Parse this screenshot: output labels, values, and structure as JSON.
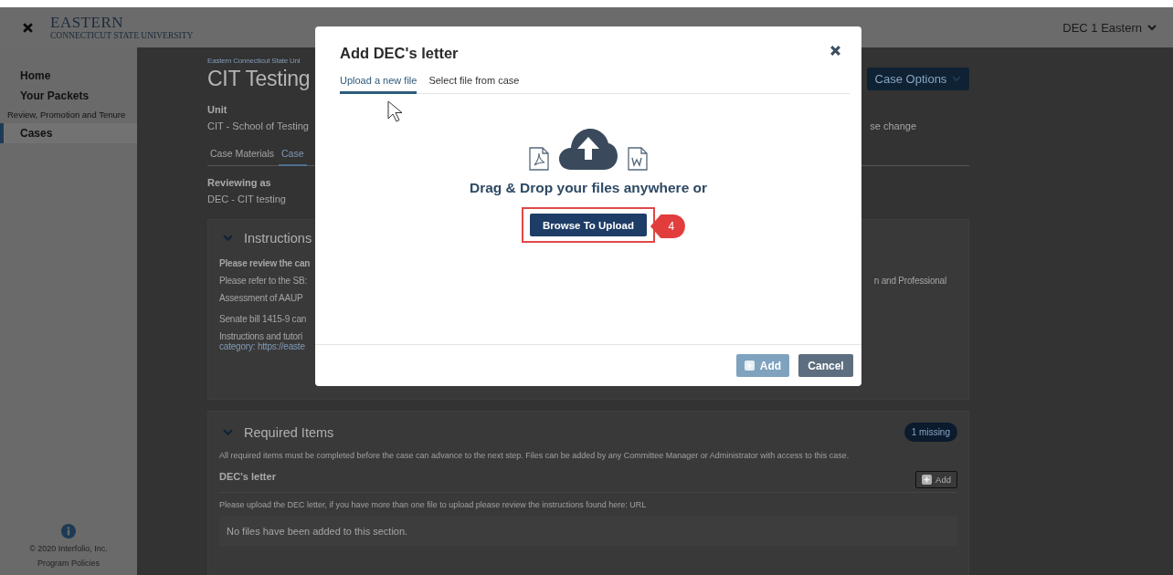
{
  "header": {
    "logo_title": "EASTERN",
    "logo_subtitle": "CONNECTICUT STATE UNIVERSITY",
    "user_menu": "DEC 1 Eastern"
  },
  "sidebar": {
    "items": [
      {
        "label": "Home",
        "selected": false
      },
      {
        "label": "Your Packets",
        "selected": false
      }
    ],
    "section": {
      "label": "Review, Promotion and Tenure",
      "items": [
        {
          "label": "Cases",
          "selected": true
        }
      ]
    },
    "copyright": "© 2020 Interfolio, Inc.",
    "policies_link": "Program Policies"
  },
  "case": {
    "breadcrumb": "Eastern Connecticut State Uni",
    "title": "CIT Testing",
    "options_button": "Case Options",
    "unit_label": "Unit",
    "unit_value": "CIT - School of Testing",
    "unit_note": "se change",
    "tabs": [
      {
        "label": "Case Materials",
        "selected": false
      },
      {
        "label": "Case",
        "selected": true
      }
    ],
    "reviewing_label": "Reviewing as",
    "reviewing_value": "DEC - CIT testing"
  },
  "instructions": {
    "title": "Instructions",
    "expanded": true,
    "lines": [
      {
        "kind": "bold",
        "left": "Please review the can"
      },
      {
        "kind": "text",
        "left": "Please refer to the SB:",
        "right": "n and Professional"
      },
      {
        "kind": "text",
        "left": "Assessment of AAUP"
      },
      {
        "kind": "gap",
        "left": "Senate bill 1415-9 can"
      },
      {
        "kind": "text",
        "left": "Instructions and tutori"
      },
      {
        "kind": "link",
        "left": "category: https://easte"
      }
    ]
  },
  "required_items": {
    "title": "Required Items",
    "expanded": true,
    "badge": "1 missing",
    "description": "All required items must be completed before the case can advance to the next step. Files can be added by any Committee Manager or Administrator with access to this case.",
    "items": [
      {
        "name": "DEC's letter",
        "add_button": "Add",
        "description": "Please upload the DEC letter, if you have more than one file to upload please review the instructions found here: URL",
        "empty_message": "No files have been added to this section."
      }
    ]
  },
  "modal": {
    "title": "Add DEC's letter",
    "tabs": [
      {
        "label": "Upload a new file",
        "selected": true
      },
      {
        "label": "Select file from case",
        "selected": false
      }
    ],
    "drop_text": "Drag & Drop your files anywhere or",
    "browse_button": "Browse To Upload",
    "callout": "4",
    "add_button": {
      "label": "Add",
      "disabled": true
    },
    "cancel_button": "Cancel"
  }
}
